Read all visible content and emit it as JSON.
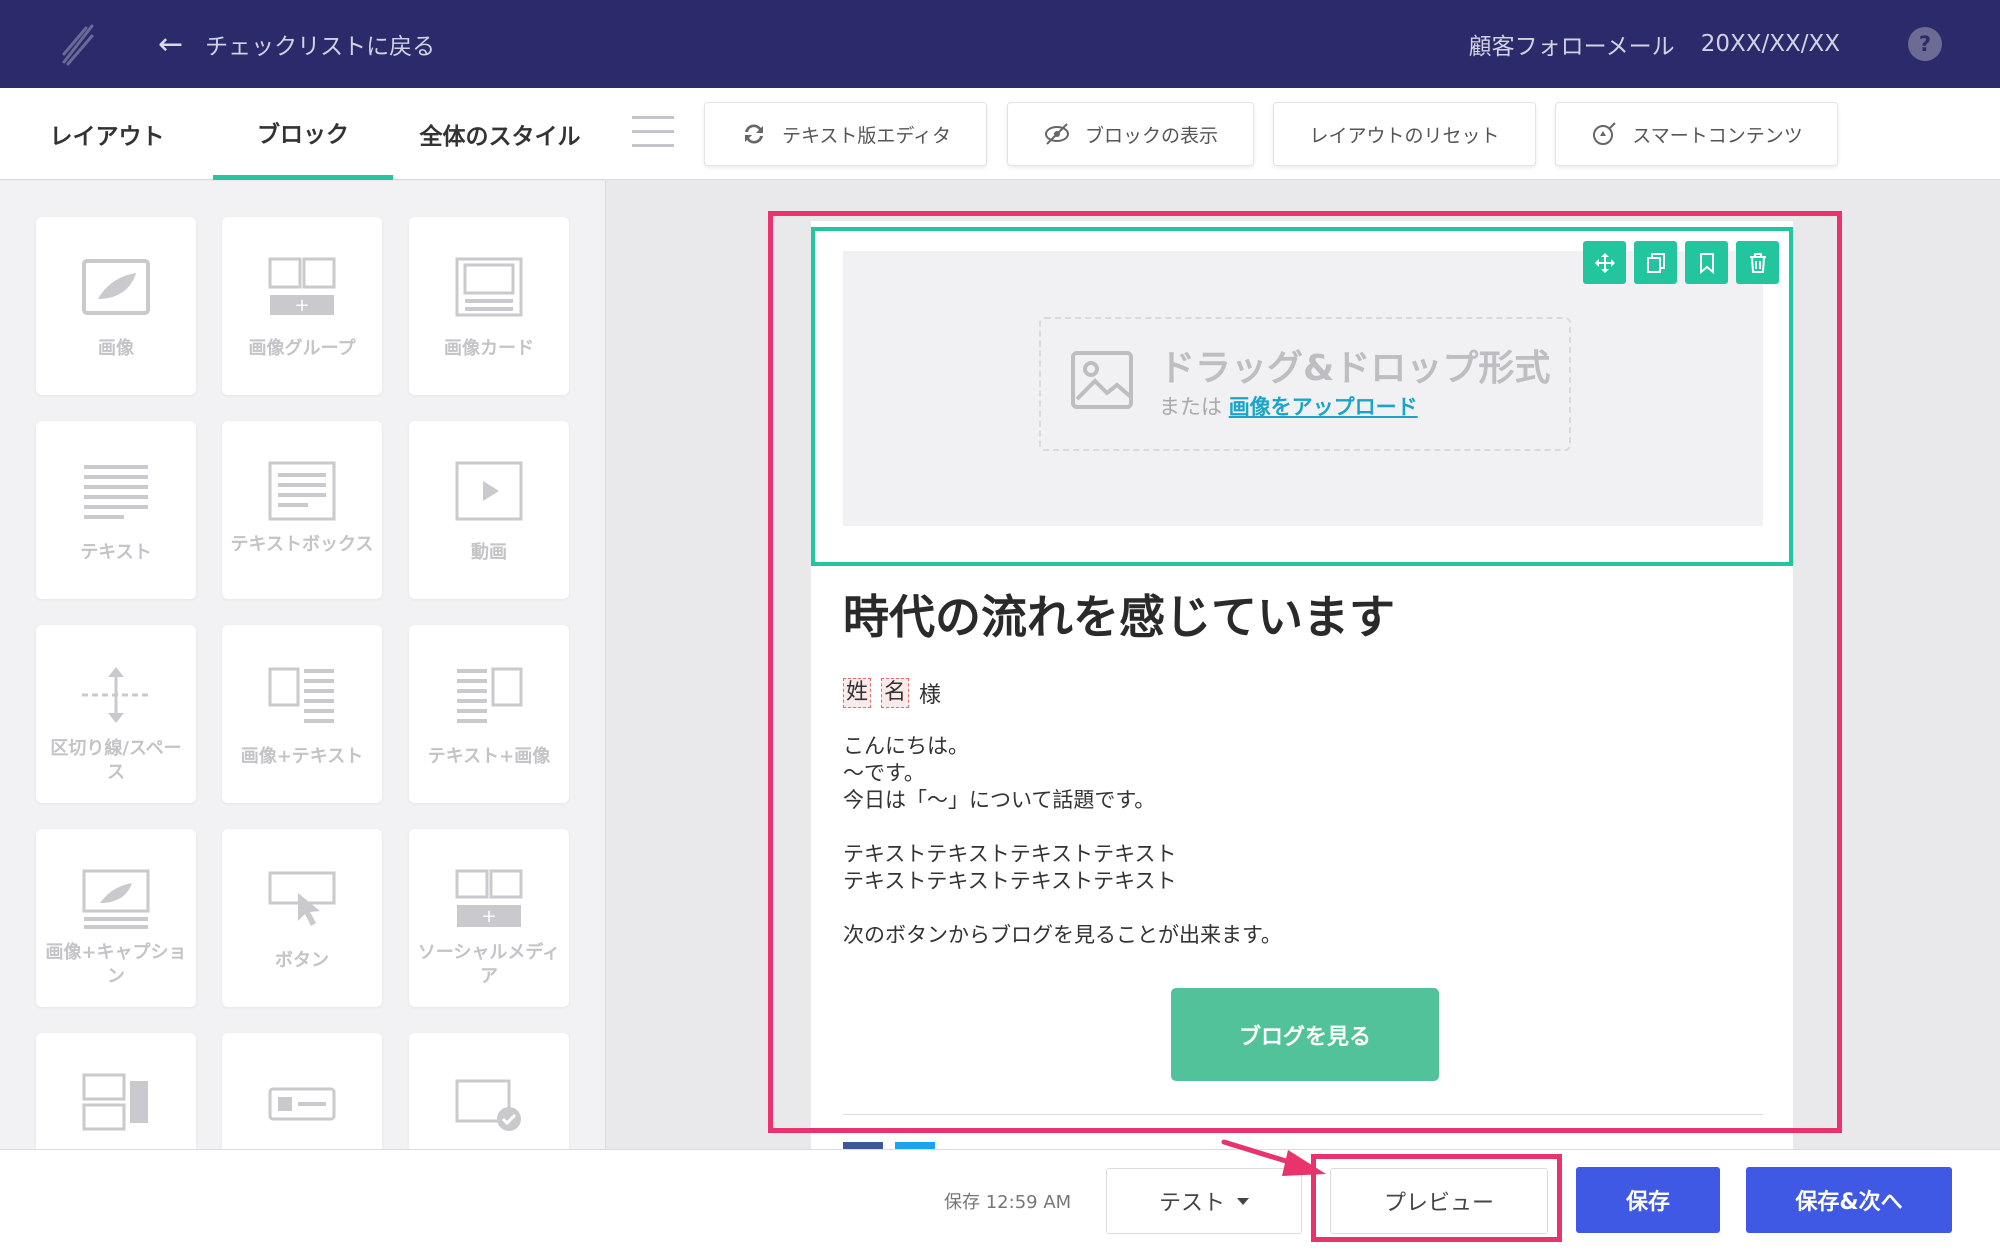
{
  "header": {
    "back_label": "チェックリストに戻る",
    "email_name": "顧客フォローメール",
    "email_date": "20XX/XX/XX",
    "help_label": "?"
  },
  "tabs": [
    "レイアウト",
    "ブロック",
    "全体のスタイル"
  ],
  "toolbar": {
    "text_editor": "テキスト版エディタ",
    "show_blocks": "ブロックの表示",
    "reset_layout": "レイアウトのリセット",
    "smart_content": "スマートコンテンツ"
  },
  "blocks": [
    {
      "label": "画像",
      "icon": "image-icon"
    },
    {
      "label": "画像グループ",
      "icon": "image-group-icon"
    },
    {
      "label": "画像カード",
      "icon": "image-card-icon"
    },
    {
      "label": "テキスト",
      "icon": "text-icon"
    },
    {
      "label": "テキストボックス",
      "icon": "textbox-icon"
    },
    {
      "label": "動画",
      "icon": "video-icon"
    },
    {
      "label": "区切り線/スペース",
      "icon": "divider-icon"
    },
    {
      "label": "画像+テキスト",
      "icon": "image-text-icon"
    },
    {
      "label": "テキスト+画像",
      "icon": "text-image-icon"
    },
    {
      "label": "画像+キャプション",
      "icon": "image-caption-icon"
    },
    {
      "label": "ボタン",
      "icon": "button-icon"
    },
    {
      "label": "ソーシャルメディア",
      "icon": "social-media-icon"
    }
  ],
  "email": {
    "dropzone_title": "ドラッグ&ドロップ形式",
    "dropzone_or": "または",
    "dropzone_link": "画像をアップロード",
    "headline": "時代の流れを感じています",
    "last_name_tag": "姓",
    "first_name_tag": "名",
    "honorific": "様",
    "body_lines": [
      "こんにちは。",
      "〜です。",
      "今日は「〜」について話題です。",
      "",
      "テキストテキストテキストテキスト",
      "テキストテキストテキストテキスト",
      "",
      "次のボタンからブログを見ることが出来ます。"
    ],
    "cta_label": "ブログを見る"
  },
  "footer": {
    "save_time": "保存 12:59 AM",
    "test_label": "テスト",
    "preview_label": "プレビュー",
    "save_label": "保存",
    "save_next_label": "保存&次へ"
  },
  "colors": {
    "topbar": "#2b2b6b",
    "accent_green": "#23c59e",
    "cta_green": "#52c29b",
    "highlight_pink": "#e8336d",
    "primary_blue": "#3f59e4"
  }
}
